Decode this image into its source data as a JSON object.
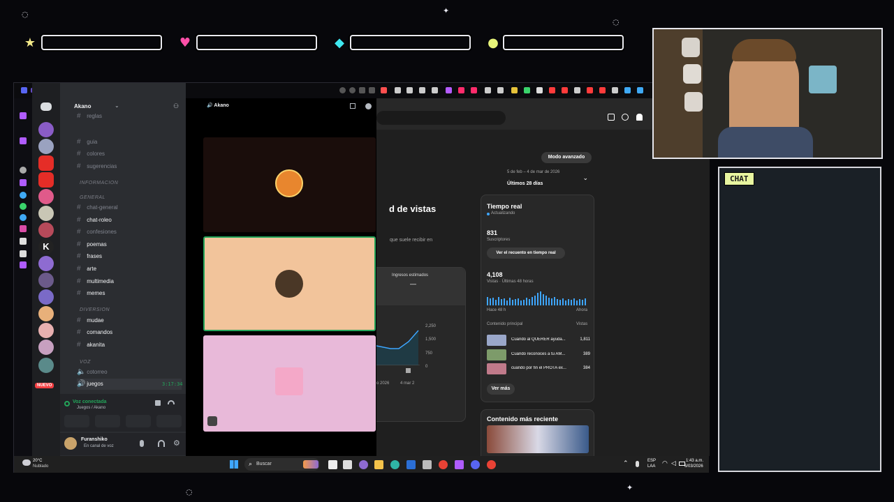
{
  "overlay": {
    "chat_title": "CHAT"
  },
  "discord": {
    "server_name": "Akano",
    "header_title": "Akano",
    "categories": [
      "INFORMACION",
      "GENERAL",
      "DIVERSION",
      "VOZ"
    ],
    "channels": [
      "reglas",
      "guia",
      "colores",
      "sugerencias",
      "chat-general",
      "chat-roleo",
      "confesiones",
      "poemas",
      "frases",
      "arte",
      "multimedia",
      "memes",
      "mudae",
      "comandos",
      "akanita",
      "cotorreo",
      "juegos"
    ],
    "voice_channel_timer": "3:17:34",
    "new_badge": "NUEVO",
    "voice_status": "Voz conectada",
    "voice_location": "Juegos / Akano",
    "user_name": "Furanshiko",
    "user_status": "En canal de voz"
  },
  "youtube": {
    "advanced_mode": "Modo avanzado",
    "date_range": "5 de feb – 4 de mar de 2026",
    "period": "Últimos 28 días",
    "page_heading_fragment": "d de vistas",
    "subtitle_fragment": "que suele recibir en",
    "earnings_label": "Ingresos estimados",
    "earnings_value": "—",
    "chart_ticks": [
      "2,250",
      "1,500",
      "750",
      "0"
    ],
    "chart_xlabels": [
      "o 2026",
      "4 mar 2"
    ],
    "realtime_title": "Tiempo real",
    "realtime_status": "Actualizando",
    "subs_value": "831",
    "subs_label": "Suscriptores",
    "realtime_button": "Ver el recuento en tiempo real",
    "views_value": "4,108",
    "views_label": "Vistas · Últimas 48 horas",
    "spark_left": "Hace 48 h",
    "spark_right": "Ahora",
    "top_content_label": "Contenido principal",
    "top_content_col": "Vistas",
    "top_videos": [
      {
        "title": "Cuando al QUERER ayuda...",
        "views": "1,811",
        "color": "#9aa7c9"
      },
      {
        "title": "Cuando reconoces a tu AM...",
        "views": "389",
        "color": "#7d9b6a"
      },
      {
        "title": "cuando por fin el PROTA ex...",
        "views": "384",
        "color": "#c07a8a"
      }
    ],
    "see_more": "Ver más",
    "recent_title": "Contenido más reciente"
  },
  "taskbar": {
    "weather_temp": "20°C",
    "weather_desc": "Nublado",
    "search": "Buscar",
    "lang_top": "ESP",
    "lang_bottom": "LAA",
    "time": "1:43 a.m.",
    "date": "6/03/2026"
  },
  "colors": {
    "discord_bg": "#2b2d31",
    "tile_dark": "#1a0d0b",
    "tile_peach": "#f2c49b",
    "tile_pink": "#e8b9d9",
    "overlay_pink": "#ff4fa8",
    "overlay_cyan": "#3fe7f0",
    "overlay_yellow": "#e8f57a"
  }
}
